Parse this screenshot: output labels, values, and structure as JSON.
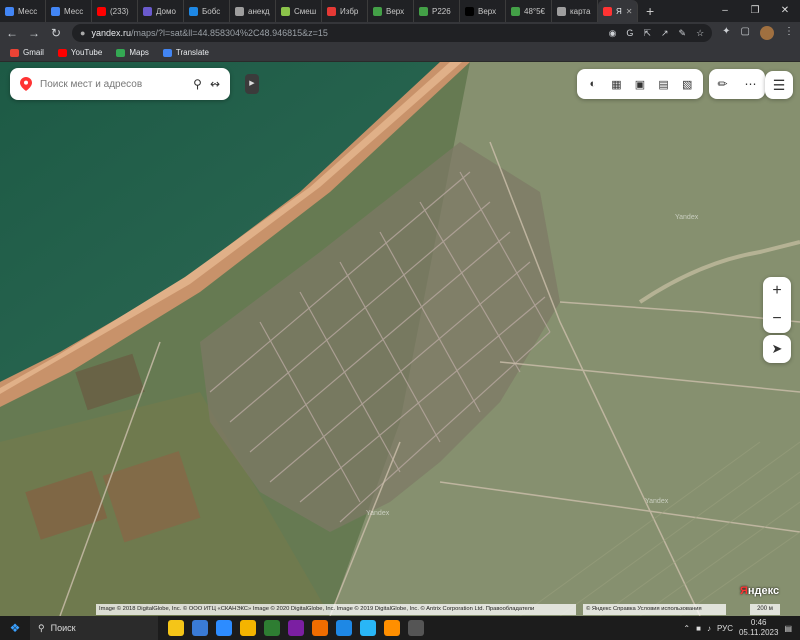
{
  "browser": {
    "tabs": [
      {
        "title": "Месс",
        "color": "#4285f4"
      },
      {
        "title": "Месс",
        "color": "#4285f4"
      },
      {
        "title": "(233)",
        "color": "#ff0000"
      },
      {
        "title": "Домо",
        "color": "#6a5acd"
      },
      {
        "title": "Бобс",
        "color": "#1e88e5"
      },
      {
        "title": "анекд",
        "color": "#9e9e9e"
      },
      {
        "title": "Смеш",
        "color": "#8bc34a"
      },
      {
        "title": "Избр",
        "color": "#e53935"
      },
      {
        "title": "Верх",
        "color": "#43a047"
      },
      {
        "title": "Р226",
        "color": "#43a047"
      },
      {
        "title": "Верх",
        "color": "#000000"
      },
      {
        "title": "48°5€",
        "color": "#43a047"
      },
      {
        "title": "карта",
        "color": "#9e9e9e"
      },
      {
        "title": "Я",
        "color": "#ff3333"
      }
    ],
    "new_tab": "+",
    "url_host": "yandex.ru",
    "url_path": "/maps/?l=sat&ll=44.858304%2C48.946815&z=15",
    "bookmarks": [
      {
        "label": "Gmail",
        "color": "#ea4335"
      },
      {
        "label": "YouTube",
        "color": "#ff0000"
      },
      {
        "label": "Maps",
        "color": "#34a853"
      },
      {
        "label": "Translate",
        "color": "#4285f4"
      }
    ]
  },
  "map": {
    "search_placeholder": "Поиск мест и адресов",
    "watermark_1": "Yandex",
    "watermark_2": "Yandex",
    "watermark_3": "Yandex",
    "logo_first": "Я",
    "logo_rest": "ндекс",
    "copyright": "Image © 2018 DigitalGlobe, Inc. © ООО ИТЦ «СКАНЭКС» Image © 2020 DigitalGlobe, Inc. Image © 2019 DigitalGlobe, Inc. © Antrix Corporation Ltd. Правообладатели",
    "links": "© Яндекс  Справка  Условия использования",
    "scale": "200 м",
    "zoom_in": "+",
    "zoom_out": "−"
  },
  "taskbar": {
    "search_label": "Поиск",
    "lang": "РУС",
    "time": "0:46",
    "date": "05.11.2023",
    "apps": [
      "#f5c518",
      "#3a7bd5",
      "#2d8cff",
      "#f4b400",
      "#2e7d32",
      "#7b1fa2",
      "#ef6c00",
      "#1e88e5",
      "#29b6f6",
      "#ff8f00",
      "#555555"
    ]
  }
}
